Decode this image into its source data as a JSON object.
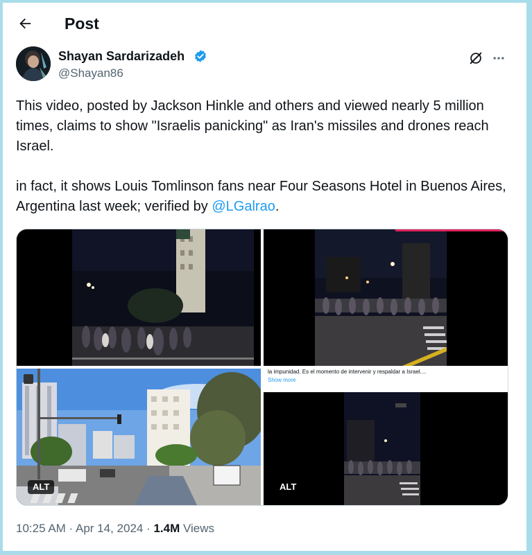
{
  "header": {
    "title": "Post"
  },
  "author": {
    "name": "Shayan Sardarizadeh",
    "handle": "@Shayan86"
  },
  "post": {
    "paragraph1": "This video, posted by Jackson Hinkle and others and viewed nearly 5 million times, claims to show \"Israelis panicking\" as Iran's missiles and drones reach Israel.",
    "paragraph2_prefix": "in fact, it shows Louis Tomlinson fans near Four Seasons Hotel in Buenos Aires, Argentina last week; verified by ",
    "mention": "@LGalrao",
    "paragraph2_suffix": "."
  },
  "media": {
    "alt_label": "ALT",
    "caption_text": "la impunidad. Es el momento de intervenir y respaldar a Israel....",
    "caption_more": "Show more"
  },
  "meta": {
    "time": "10:25 AM",
    "separator": " · ",
    "date": "Apr 14, 2024",
    "views_count": "1.4M",
    "views_label": " Views"
  },
  "colors": {
    "accent": "#1d9bf0",
    "secondary_text": "#536471",
    "frame": "#a9dcea"
  },
  "icons": [
    "back-arrow-icon",
    "verified-badge-icon",
    "grok-icon",
    "more-icon"
  ]
}
